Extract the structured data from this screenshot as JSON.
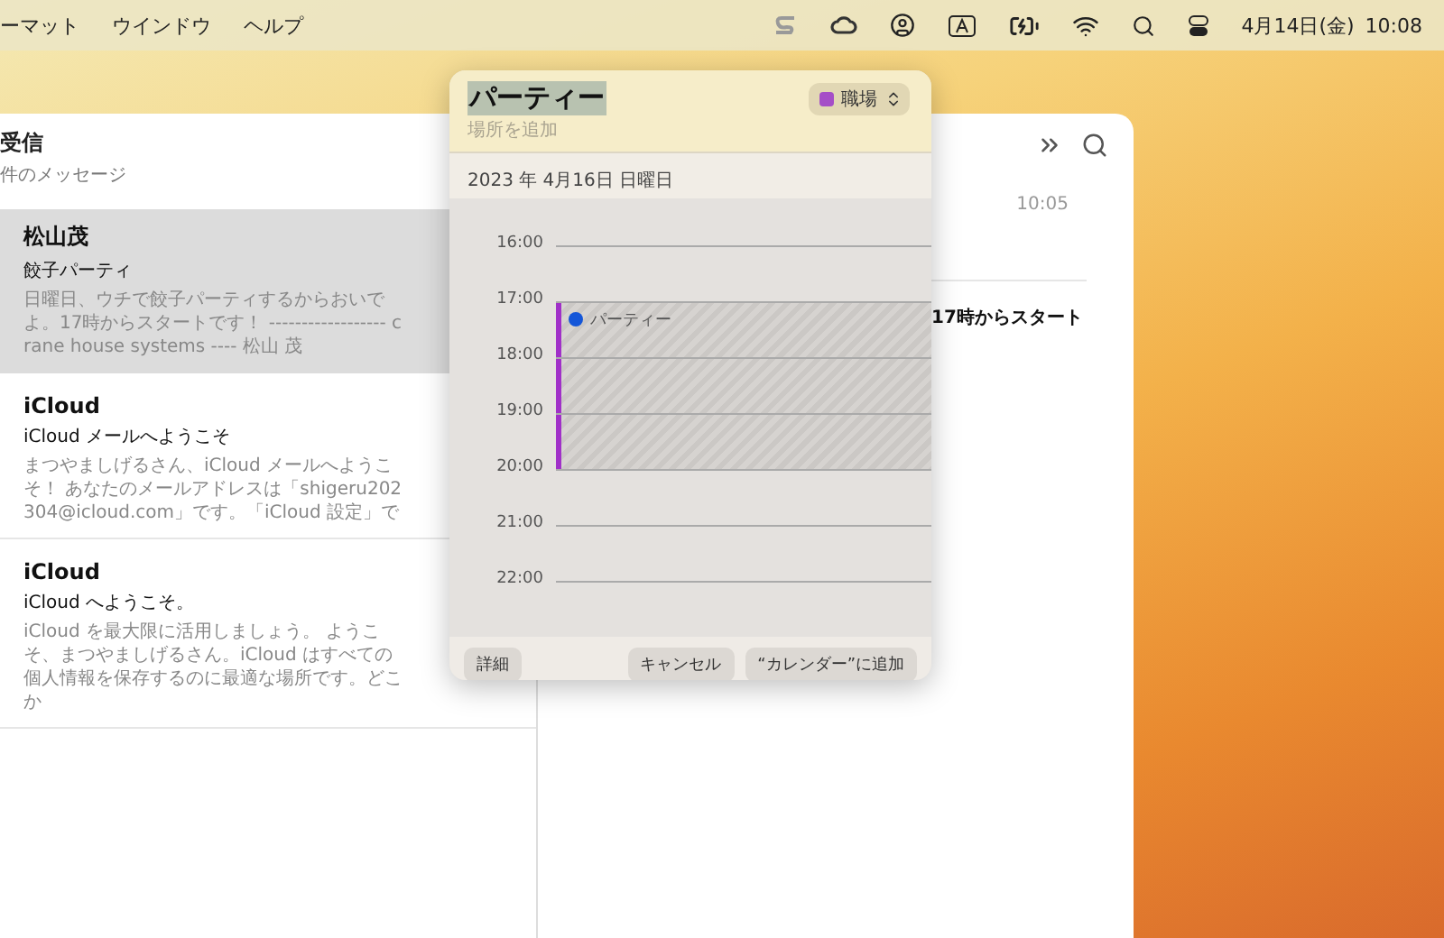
{
  "menubar": {
    "menus": [
      "ーマット",
      "ウインドウ",
      "ヘルプ"
    ],
    "date": "4月14日(金)",
    "time": "10:08"
  },
  "mailbox": {
    "title": "受信",
    "count": "件のメッセージ"
  },
  "messages": [
    {
      "sender": "松山茂",
      "subject": "餃子パーティ",
      "preview": "日曜日、ウチで餃子パーティするからおいでよ。17時からスタートです！ ------------------ crane house systems ---- 松山 茂",
      "selected": true
    },
    {
      "sender": "iCloud",
      "subject": "iCloud メールへようこそ",
      "preview": "まつやましげるさん、iCloud メールへようこそ！ あなたのメールアドレスは「shigeru202304@icloud.com」です。「iCloud 設定」で",
      "selected": false
    },
    {
      "sender": "iCloud",
      "subject": "iCloud へようこそ。",
      "preview": "iCloud を最大限に活用しましょう。 ようこそ、まつやましげるさん。iCloud はすべての個人情報を保存するのに最適な場所です。どこか",
      "selected": false
    }
  ],
  "message_view": {
    "time": "10:05",
    "body": "17時からスタート"
  },
  "event_popover": {
    "title": "パーティー",
    "calendar": {
      "name": "職場",
      "color": "#a54ec7"
    },
    "location": {
      "placeholder": "場所を追加"
    },
    "date": "2023 年 4月16日 日曜日",
    "event": {
      "title": "パーティー",
      "color": "#a030c8"
    },
    "hours": [
      {
        "label": "16:00",
        "in_event": false
      },
      {
        "label": "17:00",
        "in_event": true
      },
      {
        "label": "18:00",
        "in_event": true
      },
      {
        "label": "19:00",
        "in_event": true
      },
      {
        "label": "20:00",
        "in_event": false
      },
      {
        "label": "21:00",
        "in_event": false
      },
      {
        "label": "22:00",
        "in_event": false
      }
    ],
    "buttons": {
      "details": "詳細",
      "cancel": "キャンセル",
      "add": "“カレンダー”に追加"
    }
  }
}
